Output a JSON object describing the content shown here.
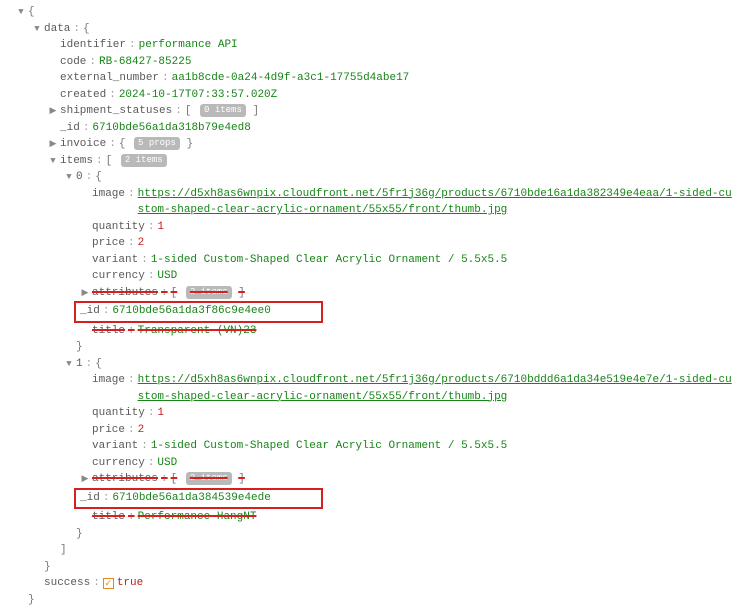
{
  "arrows": {
    "down": "▼",
    "right": "▶"
  },
  "braces": {
    "open": "{",
    "close": "}",
    "aopen": "[",
    "aclose": "]"
  },
  "colon": ":",
  "root": {
    "key": ""
  },
  "data_key": "data",
  "identifier": {
    "key": "identifier",
    "val": "performance API"
  },
  "code": {
    "key": "code",
    "val": "RB-68427-85225"
  },
  "external_number": {
    "key": "external_number",
    "val": "aa1b8cde-0a24-4d9f-a3c1-17755d4abe17"
  },
  "created": {
    "key": "created",
    "val": "2024-10-17T07:33:57.020Z"
  },
  "shipment_statuses": {
    "key": "shipment_statuses",
    "badge": "0 items"
  },
  "_id_data": {
    "key": "_id",
    "val": "6710bde56a1da318b79e4ed8"
  },
  "invoice": {
    "key": "invoice",
    "badge": "5 props"
  },
  "items": {
    "key": "items",
    "badge": "2 items"
  },
  "idx0": "0",
  "idx1": "1",
  "item0": {
    "image_key": "image",
    "image_url": "https://d5xh8as6wnpix.cloudfront.net/5fr1j36g/products/6710bde16a1da382349e4eaa/1-sided-custom-shaped-clear-acrylic-ornament/55x55/front/thumb.jpg",
    "quantity_key": "quantity",
    "quantity_val": "1",
    "price_key": "price",
    "price_val": "2",
    "variant_key": "variant",
    "variant_val": "1-sided Custom-Shaped Clear Acrylic Ornament / 5.5x5.5",
    "currency_key": "currency",
    "currency_val": "USD",
    "attributes_key": "attributes",
    "attributes_badge": "2 items",
    "id_key": "_id",
    "id_val": "6710bde56a1da3f86c9e4ee0",
    "title_key": "title",
    "title_val": "Transparent (VN)23"
  },
  "item1": {
    "image_key": "image",
    "image_url": "https://d5xh8as6wnpix.cloudfront.net/5fr1j36g/products/6710bddd6a1da34e519e4e7e/1-sided-custom-shaped-clear-acrylic-ornament/55x55/front/thumb.jpg",
    "quantity_key": "quantity",
    "quantity_val": "1",
    "price_key": "price",
    "price_val": "2",
    "variant_key": "variant",
    "variant_val": "1-sided Custom-Shaped Clear Acrylic Ornament / 5.5x5.5",
    "currency_key": "currency",
    "currency_val": "USD",
    "attributes_key": "attributes",
    "attributes_badge": "2 items",
    "id_key": "_id",
    "id_val": "6710bde56a1da384539e4ede",
    "title_key": "title",
    "title_val": "Performance HangNT"
  },
  "success": {
    "key": "success",
    "val": "true"
  }
}
